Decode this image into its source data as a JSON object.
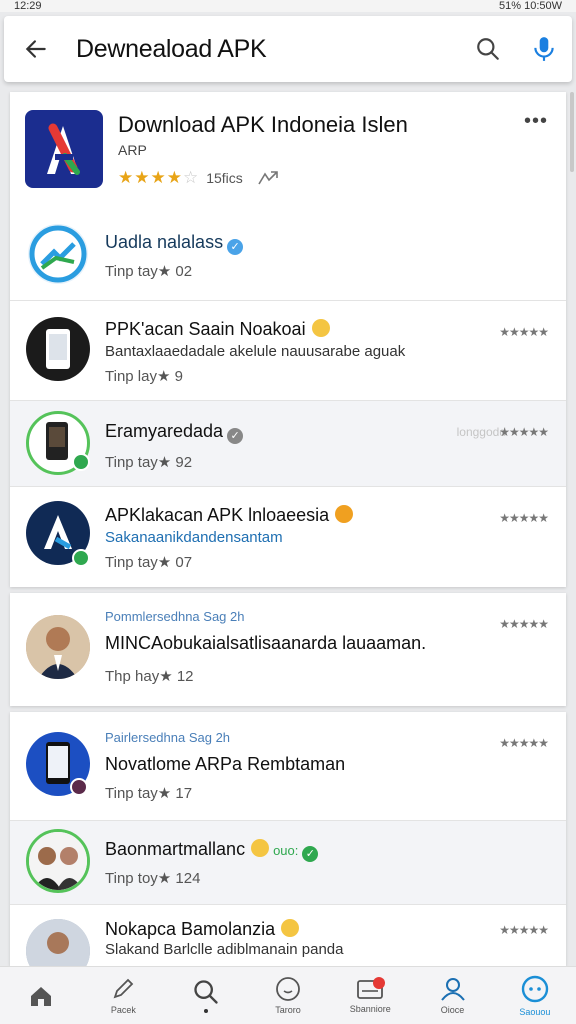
{
  "status_bar": {
    "left": "12:29",
    "right": "51% 10:50W"
  },
  "search_bar": {
    "title": "Dewneaload APK"
  },
  "featured": {
    "title": "Download APK Indoneia Islen",
    "subtitle": "ARP",
    "stars": "★★★★",
    "star_empty": "☆",
    "rating_text": "15fics",
    "accent": "#e8a417"
  },
  "rows": [
    {
      "name": "Uadla nalalass",
      "meta": "Tinp tay★ 02",
      "icon": "chart-logo-icon"
    },
    {
      "name": "PPK'acan Saain Noakoai",
      "desc": "Bantaxlaaedadale akelule nauusarabe aguak",
      "meta": "Tinp lay★ 9",
      "stars": "★★★★★"
    },
    {
      "name": "Eramyaredada",
      "meta": "Tinp tay★ 92",
      "faint": "longgodd",
      "stars": "★★★★★"
    },
    {
      "name": "APKlakacan APK lnloaeesia",
      "desc": "Sakanaanikdandensantam",
      "meta": "Tinp tay★ 07",
      "stars": "★★★★★"
    },
    {
      "top": "Pommlersedhna Sag 2h",
      "name": "MINCAobukaialsatlisaanarda lauaaman.",
      "meta": "Thp hay★ 12",
      "stars": "★★★★★"
    },
    {
      "top": "Pairlersedhna Sag 2h",
      "name": "Novatlome ARPa Rembtaman",
      "meta": "Tinp tay★ 17",
      "stars": "★★★★★"
    },
    {
      "name": "Baonmartmallanc",
      "name_extra": "ouo:",
      "meta": "Tinp toy★ 124"
    },
    {
      "name": "Nokapca Bamolanzia",
      "desc": "Slakand Barlclle adiblmanain panda",
      "stars": "★★★★★"
    }
  ],
  "bottom_nav": [
    {
      "label": "",
      "icon": "home-icon"
    },
    {
      "label": "Pacek",
      "icon": "pencil-icon"
    },
    {
      "label": "",
      "icon": "search-icon"
    },
    {
      "label": "Taroro",
      "icon": "compass-icon"
    },
    {
      "label": "Sbanniore",
      "icon": "inbox-icon"
    },
    {
      "label": "Oioce",
      "icon": "people-icon"
    },
    {
      "label": "Saouou",
      "icon": "chat-icon"
    }
  ]
}
